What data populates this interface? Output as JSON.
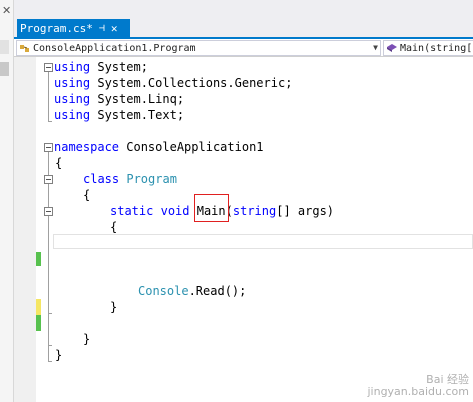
{
  "tab": {
    "title": "Program.cs*",
    "pin_glyph": "⊣",
    "close_glyph": "✕"
  },
  "left_panel": {
    "close_glyph": "✕"
  },
  "navbar": {
    "class_combo": "ConsoleApplication1.Program",
    "member_combo": "Main(string["
  },
  "code": {
    "l1": [
      "using",
      " System;"
    ],
    "l2": [
      "using",
      " System.Collections.Generic;"
    ],
    "l3": [
      "using",
      " System.Linq;"
    ],
    "l4": [
      "using",
      " System.Text;"
    ],
    "l6": [
      "namespace",
      " ConsoleApplication1"
    ],
    "l7": "{",
    "l8": [
      "class",
      "Program"
    ],
    "l9": "{",
    "l10": [
      "static",
      "void",
      "Main",
      "(",
      "string",
      "[] args)"
    ],
    "l11": "{",
    "l15": [
      "Console",
      ".Read();"
    ],
    "l16": "}",
    "l18": "}",
    "l19": "}"
  },
  "colors": {
    "accent": "#007acc",
    "keyword": "#0000ff",
    "type": "#2b91af",
    "highlight": "#e02020",
    "change_saved": "#57c14e",
    "change_unsaved": "#f5e663"
  },
  "watermark": {
    "line1": "Bai 经验",
    "line2": "jingyan.baidu.com"
  }
}
